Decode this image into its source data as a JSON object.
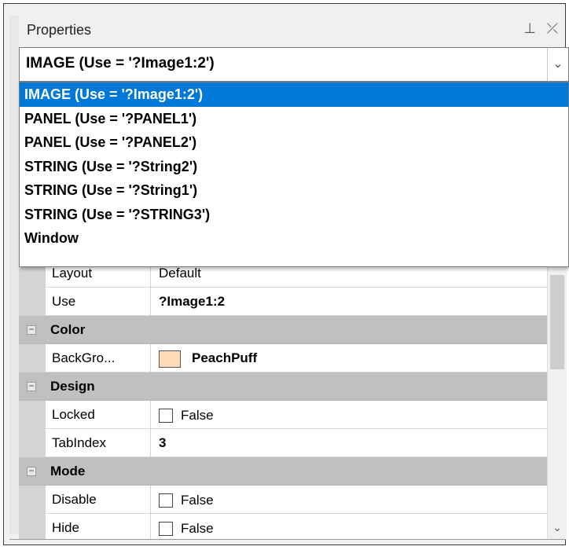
{
  "panel": {
    "title": "Properties",
    "pin_glyph": "⊥",
    "close_glyph": "⤫"
  },
  "selector": {
    "value": "IMAGE (Use = '?Image1:2')",
    "arrow_glyph": "⌄",
    "options": [
      "IMAGE (Use = '?Image1:2')",
      "PANEL (Use = '?PANEL1')",
      "PANEL (Use = '?PANEL2')",
      "STRING (Use = '?String2')",
      "STRING (Use = '?String1')",
      "STRING (Use = '?STRING3')",
      "Window"
    ]
  },
  "grid": {
    "rows": [
      {
        "kind": "prop",
        "name": "Layout",
        "value": "Default"
      },
      {
        "kind": "prop",
        "name": "Use",
        "value": "?Image1:2",
        "bold": true
      },
      {
        "kind": "category",
        "toggle": "−",
        "name": "Color"
      },
      {
        "kind": "color",
        "name": "BackGro...",
        "value": "PeachPuff",
        "swatch": "#FFDAB9"
      },
      {
        "kind": "category",
        "toggle": "−",
        "name": "Design"
      },
      {
        "kind": "check",
        "name": "Locked",
        "value": "False"
      },
      {
        "kind": "prop",
        "name": "TabIndex",
        "value": "3",
        "bold": true
      },
      {
        "kind": "category",
        "toggle": "−",
        "name": "Mode"
      },
      {
        "kind": "check",
        "name": "Disable",
        "value": "False"
      },
      {
        "kind": "check",
        "name": "Hide",
        "value": "False"
      }
    ]
  },
  "scroll": {
    "down_glyph": "⌄"
  },
  "colors": {
    "selection": "#0078d7",
    "category_bg": "#c0c0c0",
    "peachpuff": "#FFDAB9"
  }
}
